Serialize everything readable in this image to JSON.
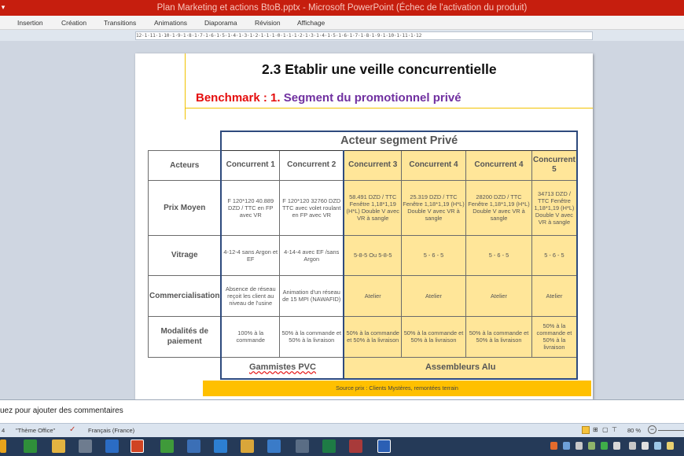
{
  "window": {
    "title": "Plan Marketing et actions BtoB.pptx - Microsoft PowerPoint (Échec de l'activation du produit)"
  },
  "ribbon_tabs": [
    "Insertion",
    "Création",
    "Transitions",
    "Animations",
    "Diaporama",
    "Révision",
    "Affichage"
  ],
  "ruler_text": "12·1·11·1·10·1·9·1·8·1·7·1·6·1·5·1·4·1·3·1·2·1·1·1·0·1·1·1·2·1·3·1·4·1·5·1·6·1·7·1·8·1·9·1·10·1·11·1·12",
  "slide": {
    "title": "2.3 Etablir une veille concurrentielle",
    "benchmark_label": "Benchmark : 1.",
    "benchmark_segment": "Segment du promotionnel privé",
    "table": {
      "super_header": "Acteur segment Privé",
      "corner": "Acteurs",
      "columns": [
        "Concurrent 1",
        "Concurrent 2",
        "Concurrent 3",
        "Concurrent 4",
        "Concurrent 4",
        "Concurrent 5"
      ],
      "rows": [
        {
          "label": "Prix Moyen",
          "cells": [
            "F 120*120 40.889 DZD / TTC en FP avec VR",
            "F 120*120 32760 DZD TTC avec volet roulant en FP avec VR",
            "58.491 DZD / TTC Fenêtre 1,18*1,19 (H*L) Double V avec VR à sangle",
            "25.319 DZD / TTC Fenêtre 1,18*1,19 (H*L) Double V avec VR à sangle",
            "28200 DZD / TTC Fenêtre 1,18*1,19 (H*L) Double V avec VR à sangle",
            "34713 DZD / TTC Fenêtre 1,18*1,19 (H*L) Double V avec VR à sangle"
          ]
        },
        {
          "label": "Vitrage",
          "cells": [
            "4-12-4 sans Argon et EF",
            "4-14-4 avec EF /sans Argon",
            "5-8-5 Ou 5-8-5",
            "5 - 6 - 5",
            "5 - 6 - 5",
            "5 - 6 - 5"
          ]
        },
        {
          "label": "Commercialisation",
          "cells": [
            "Absence de réseau reçoit les client au niveau de l'usine",
            "Animation d'un réseau de 15 MPI (NAWAFID)",
            "Atelier",
            "Atelier",
            "Atelier",
            "Atelier"
          ]
        },
        {
          "label": "Modalités de paiement",
          "cells": [
            "100% à la commande",
            "50% à la commande et 50% à la livraison",
            "50% à la commande et 50% à la livraison",
            "50% à la commande et 50% à la livraison",
            "50% à la commande et 50% à la livraison",
            "50% à la commande et 50% à la livraison"
          ]
        }
      ],
      "group_left": "Gammistes PVC",
      "group_right": "Assembleurs Alu"
    },
    "source": "Source prix : Clients Mystères, remontées terrain"
  },
  "notes_placeholder": "uez pour ajouter des commentaires",
  "status": {
    "slide": "4",
    "theme": "\"Thème Office\"",
    "language": "Français (France)",
    "zoom": "80 %"
  },
  "colors": {
    "titlebar": "#c61e0e",
    "accent_red": "#e50d0d",
    "accent_purple": "#7030a0",
    "yellow_fill": "#ffe699",
    "source_bar": "#ffc000"
  }
}
